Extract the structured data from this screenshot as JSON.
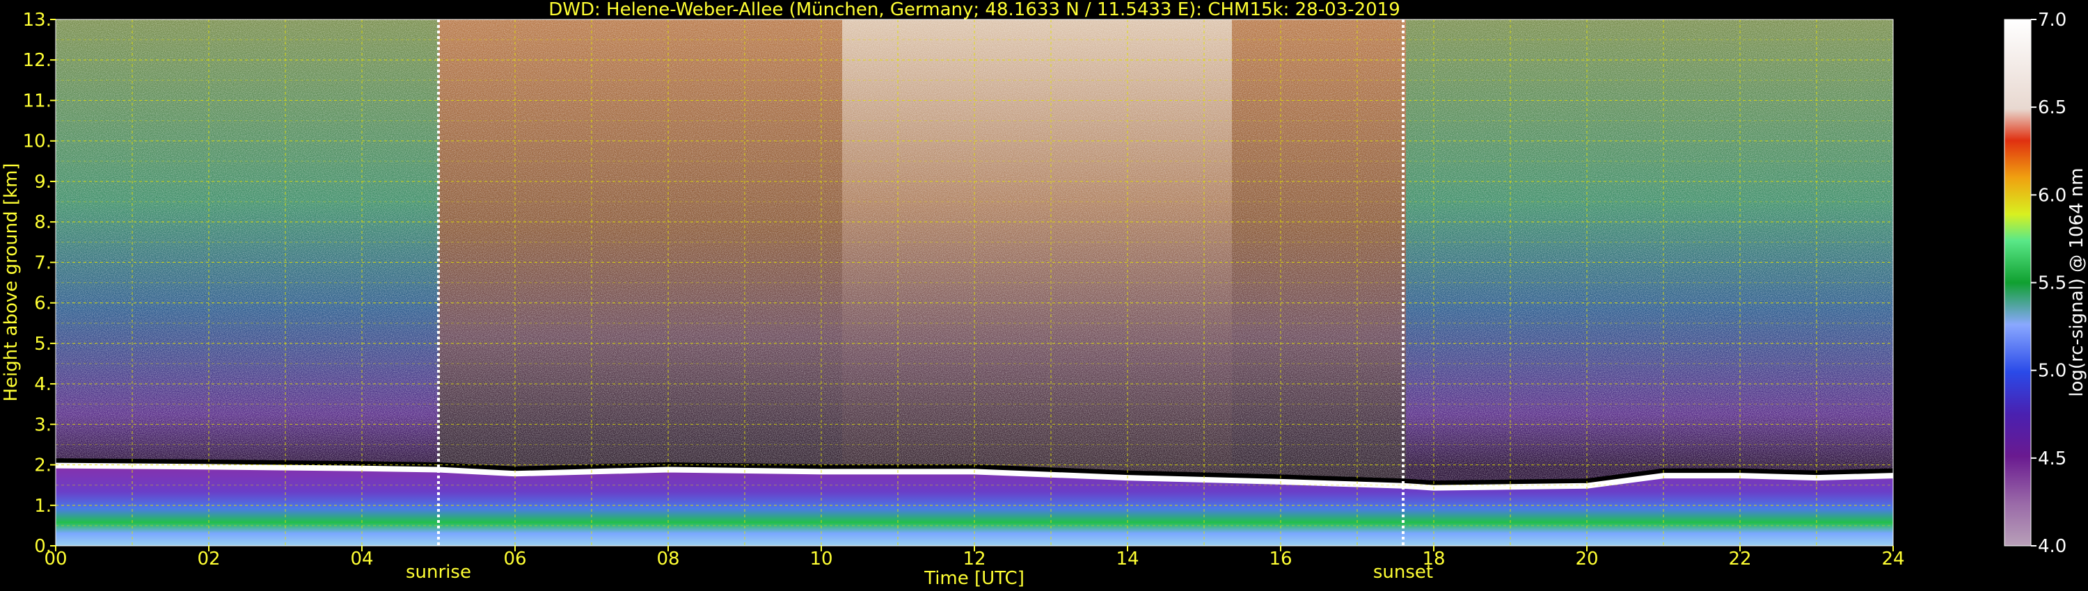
{
  "chart_data": {
    "type": "heatmap",
    "title": "DWD: Helene-Weber-Allee (München, Germany; 48.1633 N / 11.5433 E):    CHM15k: 28-03-2019",
    "xlabel": "Time [UTC]",
    "ylabel": "Height above ground [km]",
    "xlim": [
      0,
      24
    ],
    "ylim": [
      0,
      13
    ],
    "x_ticks": [
      "00",
      "02",
      "04",
      "06",
      "08",
      "10",
      "12",
      "14",
      "16",
      "18",
      "20",
      "22",
      "24"
    ],
    "y_ticks": [
      "0.",
      "1.",
      "2.",
      "3.",
      "4.",
      "5.",
      "6.",
      "7.",
      "8.",
      "9.",
      "10.",
      "11.",
      "12.",
      "13."
    ],
    "grid": true,
    "colorbar": {
      "label": "log(rc-signal) @ 1064 nm",
      "range": [
        4.0,
        7.0
      ],
      "ticks": [
        "4.0",
        "4.5",
        "5.0",
        "5.5",
        "6.0",
        "6.5",
        "7.0"
      ]
    },
    "events": [
      {
        "name": "sunrise",
        "time": 5.0
      },
      {
        "name": "sunset",
        "time": 17.6
      }
    ],
    "boundary_layer_top_km": {
      "time": [
        0,
        2,
        4,
        5,
        6,
        8,
        10,
        12,
        14,
        16,
        17.6,
        18,
        20,
        21,
        22,
        23,
        24
      ],
      "height": [
        2.05,
        2.02,
        1.98,
        1.95,
        1.85,
        1.95,
        1.9,
        1.9,
        1.75,
        1.65,
        1.55,
        1.5,
        1.55,
        1.8,
        1.8,
        1.75,
        1.8
      ]
    }
  }
}
